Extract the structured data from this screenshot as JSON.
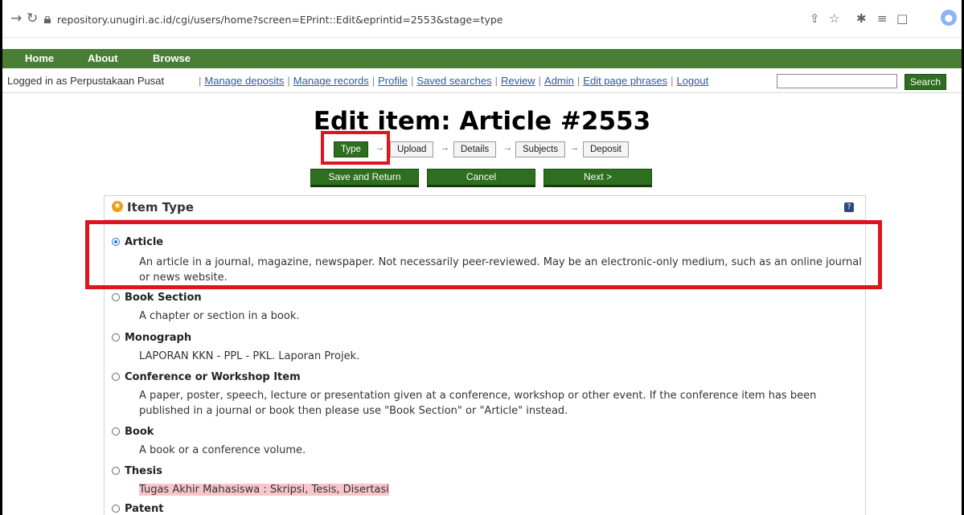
{
  "browser": {
    "url": "repository.unugiri.ac.id/cgi/users/home?screen=EPrint::Edit&eprintid=2553&stage=type"
  },
  "menu": {
    "items": [
      "Home",
      "About",
      "Browse"
    ]
  },
  "userbar": {
    "logged_in_text": "Logged in as Perpustakaan Pusat",
    "links": [
      "Manage deposits",
      "Manage records",
      "Profile",
      "Saved searches",
      "Review",
      "Admin",
      "Edit page phrases",
      "Logout"
    ],
    "search_button": "Search"
  },
  "page_title": "Edit item: Article #2553",
  "steps": [
    "Type",
    "Upload",
    "Details",
    "Subjects",
    "Deposit"
  ],
  "actions": {
    "save": "Save and Return",
    "cancel": "Cancel",
    "next": "Next >"
  },
  "panel": {
    "title": "Item Type",
    "help": "?",
    "options": [
      {
        "name": "Article",
        "desc": [
          "An article in a journal, magazine, newspaper. Not necessarily peer-reviewed. May be an electronic-only medium, such as an online journal",
          "or news website."
        ],
        "selected": true
      },
      {
        "name": "Book Section",
        "desc": [
          "A chapter or section in a book."
        ]
      },
      {
        "name": "Monograph",
        "desc": [
          "LAPORAN KKN - PPL - PKL. Laporan Projek."
        ]
      },
      {
        "name": "Conference or Workshop Item",
        "desc": [
          "A paper, poster, speech, lecture or presentation given at a conference, workshop or other event. If the conference item has been",
          "published in a journal or book then please use \"Book Section\" or \"Article\" instead."
        ]
      },
      {
        "name": "Book",
        "desc": [
          "A book or a conference volume."
        ]
      },
      {
        "name": "Thesis",
        "desc": [
          "Tugas Akhir Mahasiswa : Skripsi, Tesis, Disertasi"
        ],
        "highlight": true
      },
      {
        "name": "Patent",
        "desc": []
      }
    ]
  },
  "colors": {
    "green": "#4a7d35",
    "button_green": "#2d6e1f",
    "annotation_red": "#e0141c"
  }
}
